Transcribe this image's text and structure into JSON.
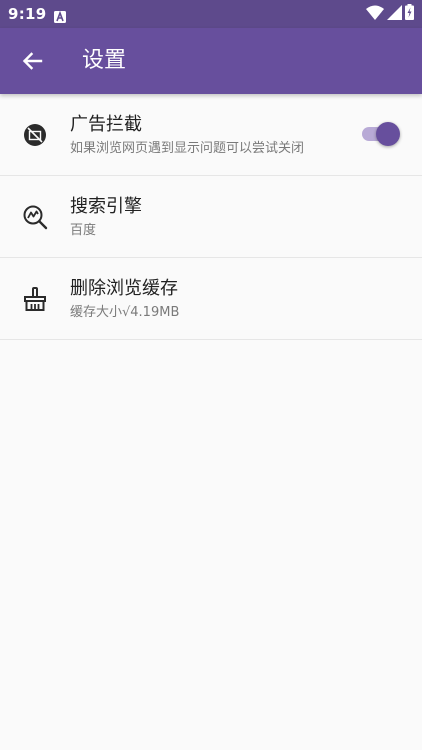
{
  "status_bar": {
    "time": "9:19",
    "notification_icon": "a-notification-icon",
    "icons": [
      "wifi-icon",
      "signal-icon",
      "battery-charging-icon"
    ]
  },
  "app_bar": {
    "title": "设置",
    "back_icon": "arrow-back-icon",
    "color": "#674f9d"
  },
  "settings": {
    "ad_block": {
      "icon": "ad-block-icon",
      "title": "广告拦截",
      "subtitle": "如果浏览网页遇到显示问题可以尝试关闭",
      "enabled": true
    },
    "search_engine": {
      "icon": "search-engine-icon",
      "title": "搜索引擎",
      "subtitle": "百度"
    },
    "clear_cache": {
      "icon": "broom-icon",
      "title": "删除浏览缓存",
      "subtitle": "缓存大小√4.19MB"
    }
  },
  "colors": {
    "status_bar": "#5e4a8c",
    "accent": "#674f9d",
    "toggle_track": "#b8aad6",
    "background": "#fafafa"
  }
}
